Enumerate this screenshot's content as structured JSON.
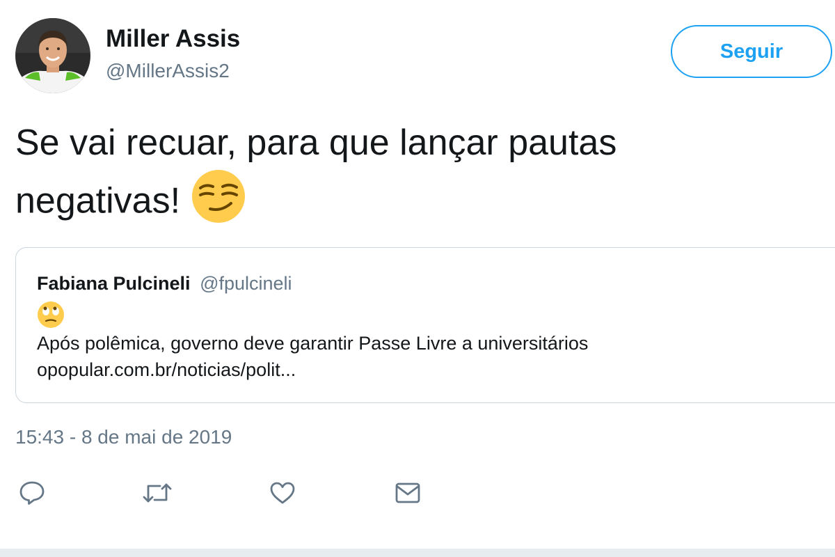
{
  "author": {
    "name": "Miller Assis",
    "handle": "@MillerAssis2"
  },
  "follow_button": {
    "label": "Seguir"
  },
  "tweet": {
    "text_line1": "Se vai recuar, para que lançar pautas",
    "text_line2": "negativas!",
    "emoji": "smirking-face"
  },
  "quoted_tweet": {
    "name": "Fabiana Pulcineli",
    "handle": "@fpulcineli",
    "emoji": "face-with-rolling-eyes",
    "text": "Após polêmica, governo deve garantir Passe Livre a universitários",
    "link": "opopular.com.br/noticias/polit..."
  },
  "timestamp": "15:43 - 8 de mai de 2019",
  "actions": [
    {
      "icon": "reply-icon"
    },
    {
      "icon": "retweet-icon"
    },
    {
      "icon": "like-icon"
    },
    {
      "icon": "direct-message-icon"
    }
  ],
  "colors": {
    "accent": "#1da1f2",
    "text": "#14171a",
    "secondary": "#657786",
    "border": "#ccd6dd"
  }
}
